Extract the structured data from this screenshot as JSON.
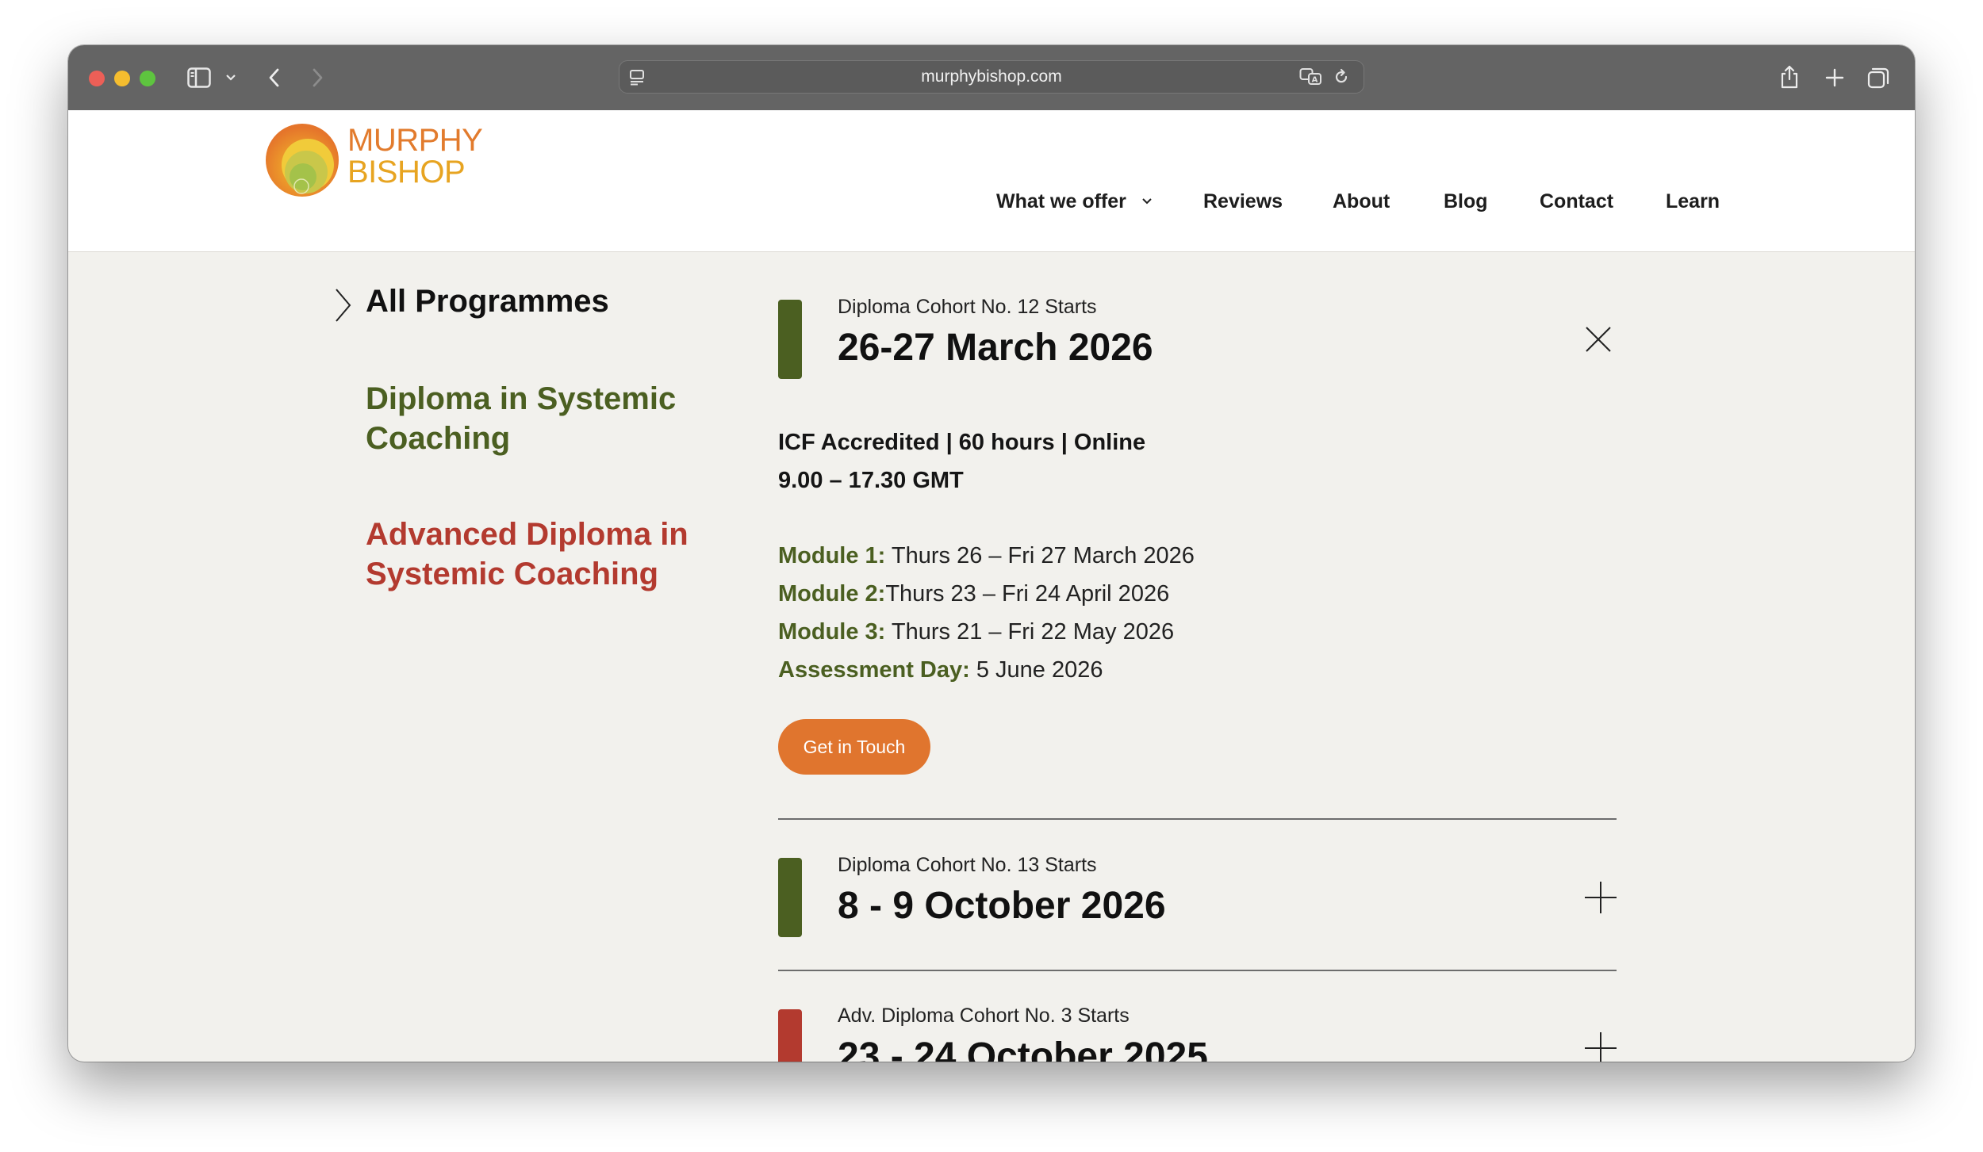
{
  "browser": {
    "url": "murphybishop.com",
    "traffic_colors": [
      "#ec5f57",
      "#f5bd2f",
      "#5ec43f"
    ]
  },
  "brand": {
    "line1": "MURPHY",
    "line2": "BISHOP"
  },
  "nav": {
    "items": [
      "What we offer",
      "Reviews",
      "About",
      "Blog",
      "Contact",
      "Learn"
    ]
  },
  "sidebar": {
    "all_programmes": "All Programmes",
    "diploma": "Diploma in Systemic Coaching",
    "advanced": "Advanced Diploma in Systemic Coaching",
    "colors": {
      "diploma": "#4b5f21",
      "advanced": "#b33a2f"
    }
  },
  "cohorts": [
    {
      "subtitle": "Diploma Cohort No. 12 Starts",
      "title": "26-27 March 2026",
      "color": "#4b5f21",
      "expanded": true,
      "details": {
        "line1": "ICF Accredited | 60 hours | Online",
        "line2": "9.00 – 17.30 GMT",
        "modules": [
          {
            "label": "Module 1:",
            "value": " Thurs 26 – Fri 27 March 2026"
          },
          {
            "label": "Module 2:",
            "value": "Thurs 23 – Fri 24 April 2026"
          },
          {
            "label": "Module 3:",
            "value": " Thurs 21 – Fri 22 May 2026"
          },
          {
            "label": "Assessment Day:",
            "value": " 5 June 2026"
          }
        ],
        "cta": "Get in Touch"
      }
    },
    {
      "subtitle": "Diploma Cohort No. 13 Starts",
      "title": "8 - 9 October 2026",
      "color": "#4b5f21",
      "expanded": false
    },
    {
      "subtitle": "Adv. Diploma Cohort No. 3 Starts",
      "title": "23 - 24 October 2025",
      "color": "#b33a2f",
      "expanded": false
    }
  ],
  "cta_color": "#e0752e"
}
